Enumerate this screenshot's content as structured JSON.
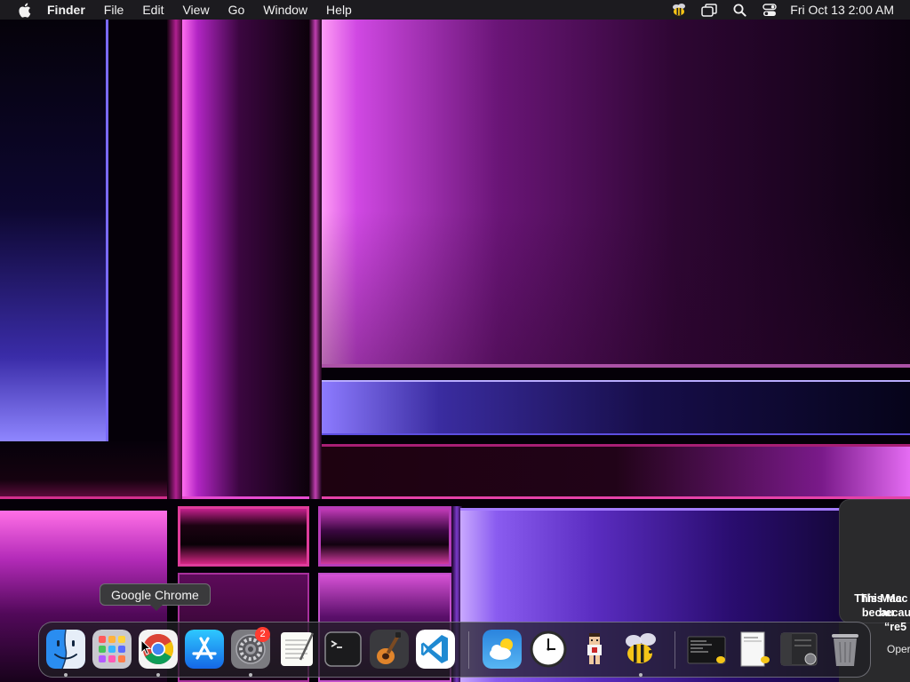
{
  "menubar": {
    "apple_icon": "apple-logo-icon",
    "app_name": "Finder",
    "menus": [
      "File",
      "Edit",
      "View",
      "Go",
      "Window",
      "Help"
    ],
    "status_icons": [
      "bee-icon",
      "window-switcher-icon",
      "search-icon",
      "control-center-icon"
    ],
    "clock": "Fri Oct 13  2:00 AM"
  },
  "tooltip": {
    "label": "Google Chrome"
  },
  "notification": {
    "lines": [
      "This Mac",
      "becau",
      "“re5"
    ],
    "action": "Oper"
  },
  "dock": {
    "items": [
      {
        "name": "Finder",
        "icon": "finder-icon",
        "running": true
      },
      {
        "name": "Launchpad",
        "icon": "launchpad-icon",
        "running": false
      },
      {
        "name": "Google Chrome",
        "icon": "chrome-icon",
        "running": true
      },
      {
        "name": "App Store",
        "icon": "app-store-icon",
        "running": false
      },
      {
        "name": "System Settings",
        "icon": "system-settings-icon",
        "running": true,
        "badge": "2"
      },
      {
        "name": "TextEdit",
        "icon": "textedit-icon",
        "running": false
      },
      {
        "name": "Terminal",
        "icon": "terminal-icon",
        "running": false
      },
      {
        "name": "GarageBand",
        "icon": "garageband-icon",
        "running": false
      },
      {
        "name": "Visual Studio Code",
        "icon": "vscode-icon",
        "running": false
      },
      {
        "name": "Weather",
        "icon": "weather-icon",
        "running": false
      },
      {
        "name": "Clock",
        "icon": "clock-icon",
        "running": false
      },
      {
        "name": "Character",
        "icon": "pixel-character-icon",
        "running": false
      },
      {
        "name": "Bee",
        "icon": "bee-app-icon",
        "running": true
      },
      {
        "name": "Terminal Window",
        "icon": "terminal-window-thumbnail-icon",
        "running": false
      },
      {
        "name": "Document Window",
        "icon": "document-window-thumbnail-icon",
        "running": false
      },
      {
        "name": "Settings Window",
        "icon": "settings-window-thumbnail-icon",
        "running": false
      },
      {
        "name": "Trash",
        "icon": "trash-icon",
        "running": false
      }
    ]
  }
}
